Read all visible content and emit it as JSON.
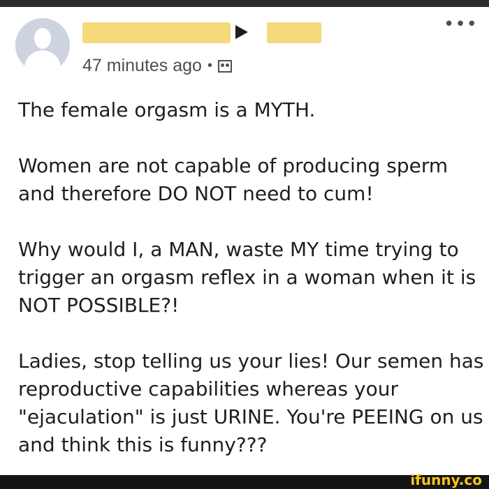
{
  "post_header": {
    "timestamp": "47 minutes ago",
    "separator": "•",
    "audience_icon": "group-icon",
    "more_icon": "•••"
  },
  "post_body": {
    "paragraph_1": "The female orgasm is a MYTH.",
    "paragraph_2": "Women are not capable of producing sperm and therefore DO NOT need to cum!",
    "paragraph_3": "Why would I, a MAN, waste MY time trying to trigger an orgasm reflex in a woman when it is NOT POSSIBLE?!",
    "paragraph_4": "Ladies, stop telling us your lies! Our semen has reproductive capabilities whereas your \"ejaculation\" is just URINE. You're PEEING on us and think this is funny???"
  },
  "watermark": "ifunny.co",
  "colors": {
    "redaction": "#f5d97a",
    "text": "#1c1e21",
    "meta": "#4b4f56",
    "watermark": "#f5c518"
  }
}
